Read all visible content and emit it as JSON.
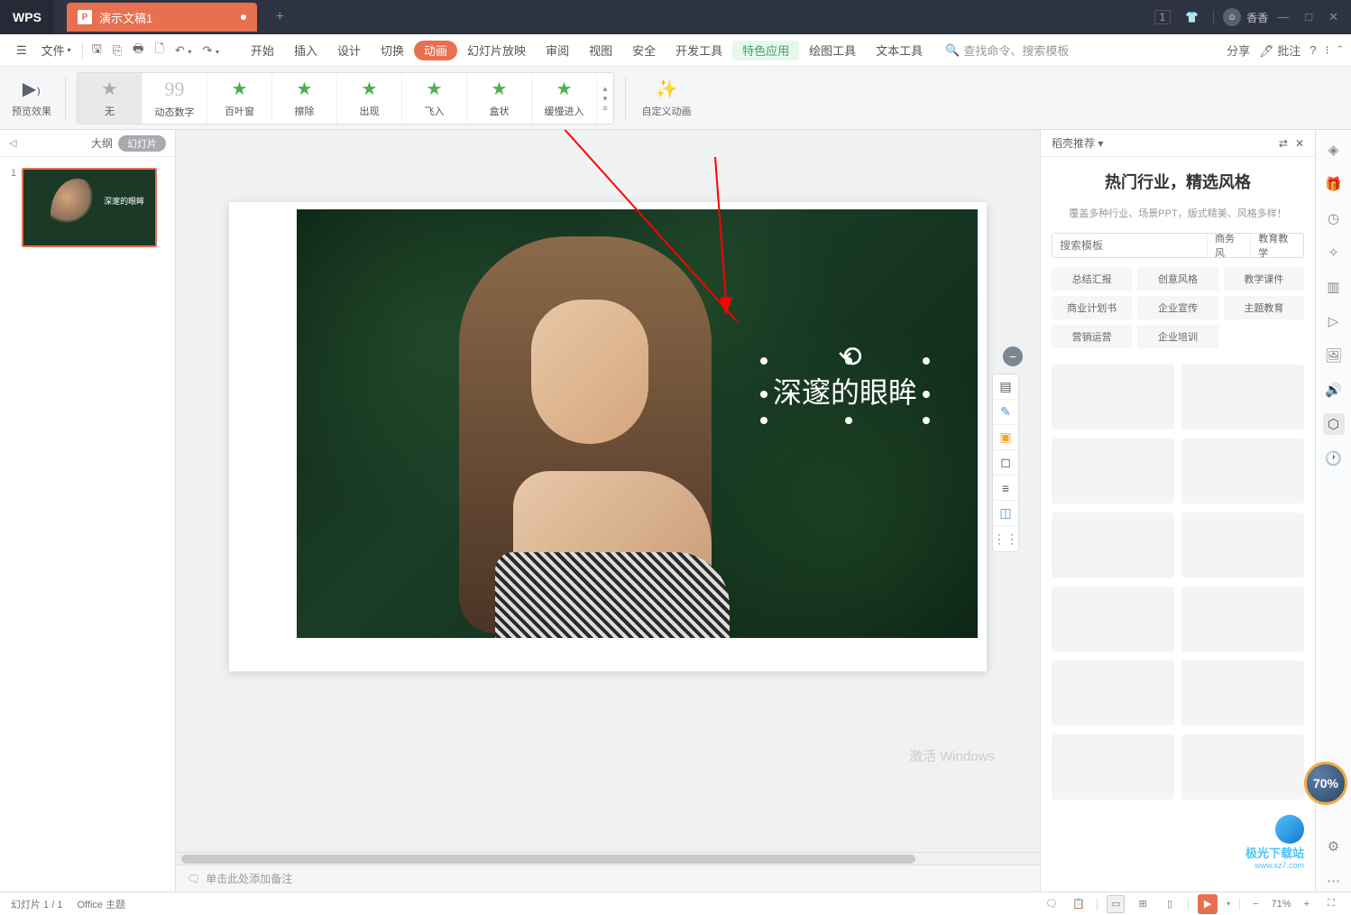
{
  "titlebar": {
    "logo": "WPS",
    "doc_name": "演示文稿1",
    "new_tab": "+",
    "badge": "1",
    "user": "香香",
    "win": {
      "min": "—",
      "max": "□",
      "close": "✕"
    }
  },
  "toolbar1": {
    "file": "文件",
    "tabs": [
      "开始",
      "插入",
      "设计",
      "切换",
      "动画",
      "幻灯片放映",
      "审阅",
      "视图",
      "安全",
      "开发工具",
      "特色应用",
      "绘图工具",
      "文本工具"
    ],
    "active_tab": "动画",
    "feature_tab": "特色应用",
    "search_placeholder": "查找命令、搜索模板",
    "share": "分享",
    "annotate": "批注"
  },
  "toolbar2": {
    "preview": "预览效果",
    "effects": [
      "无",
      "动态数字",
      "百叶窗",
      "擦除",
      "出现",
      "飞入",
      "盒状",
      "缓慢进入"
    ],
    "custom": "自定义动画"
  },
  "left": {
    "outline": "大纲",
    "slides": "幻灯片",
    "thumb_num": "1",
    "thumb_text": "深邃的眼眸"
  },
  "canvas": {
    "text": "深邃的眼眸",
    "float_icons": [
      "⊝",
      "▤",
      "✎",
      "▣",
      "◻",
      "≡",
      "◫",
      "⋮⋮"
    ]
  },
  "notes": {
    "placeholder": "单击此处添加备注"
  },
  "right": {
    "header": "稻壳推荐",
    "title": "热门行业，精选风格",
    "subtitle": "覆盖多种行业、场景PPT，版式精美、风格多样！",
    "search_placeholder": "搜索模板",
    "tag_btns": [
      "商务风",
      "教育教学"
    ],
    "tags": [
      "总结汇报",
      "创意风格",
      "教学课件",
      "商业计划书",
      "企业宣传",
      "主题教育",
      "营销运营",
      "企业培训"
    ]
  },
  "status": {
    "slide_info": "幻灯片 1 / 1",
    "theme": "Office 主题",
    "zoom": "71%"
  },
  "activate": "激活 Windows",
  "watermark": {
    "text": "极光下载站",
    "url": "www.xz7.com"
  },
  "badge70": "70%"
}
